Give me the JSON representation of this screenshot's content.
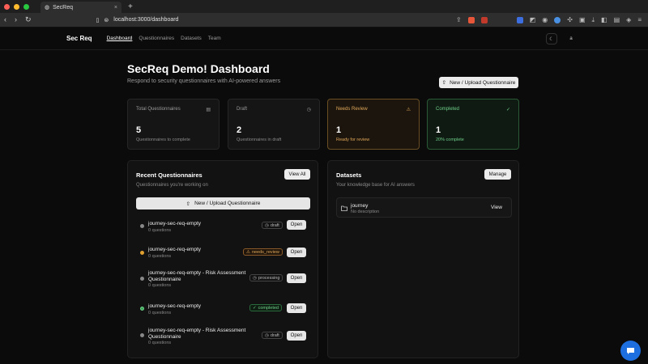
{
  "browser": {
    "tab_title": "SecReq",
    "url": "localhost:3000/dashboard"
  },
  "nav": {
    "brand": "Sec Req",
    "links": [
      "Dashboard",
      "Questionnaires",
      "Datasets",
      "Team"
    ],
    "avatar": "a"
  },
  "header": {
    "title": "SecReq Demo! Dashboard",
    "subtitle": "Respond to security questionnaires with AI-powered answers",
    "upload_button": "New / Upload Questionnaire"
  },
  "stats": [
    {
      "label": "Total Questionnaires",
      "value": "5",
      "caption": "Questionnaires to complete",
      "icon": "document-icon"
    },
    {
      "label": "Draft",
      "value": "2",
      "caption": "Questionnaires in draft",
      "icon": "clock-icon"
    },
    {
      "label": "Needs Review",
      "value": "1",
      "caption": "Ready for review",
      "icon": "warning-icon"
    },
    {
      "label": "Completed",
      "value": "1",
      "caption": "20% complete",
      "icon": "check-circle-icon"
    }
  ],
  "recent": {
    "title": "Recent Questionnaires",
    "description": "Questionnaires you're working on",
    "view_all": "View All",
    "upload_button": "New / Upload Questionnaire",
    "items": [
      {
        "name": "journey-sec-req-empty",
        "sub": "0 questions",
        "status": "draft",
        "open": "Open"
      },
      {
        "name": "journey-sec-req-empty",
        "sub": "0 questions",
        "status": "needs_review",
        "open": "Open"
      },
      {
        "name": "journey-sec-req-empty - Risk Assessment Questionnaire",
        "sub": "0 questions",
        "status": "processing",
        "open": "Open"
      },
      {
        "name": "journey-sec-req-empty",
        "sub": "0 questions",
        "status": "completed",
        "open": "Open"
      },
      {
        "name": "journey-sec-req-empty - Risk Assessment Questionnaire",
        "sub": "0 questions",
        "status": "draft",
        "open": "Open"
      }
    ]
  },
  "datasets": {
    "title": "Datasets",
    "description": "Your knowledge base for AI answers",
    "manage": "Manage",
    "items": [
      {
        "name": "journey",
        "description": "No description",
        "view": "View"
      }
    ]
  },
  "colors": {
    "review": "#e0a85a",
    "completed": "#6fd08a",
    "chat": "#1d6fe0"
  }
}
